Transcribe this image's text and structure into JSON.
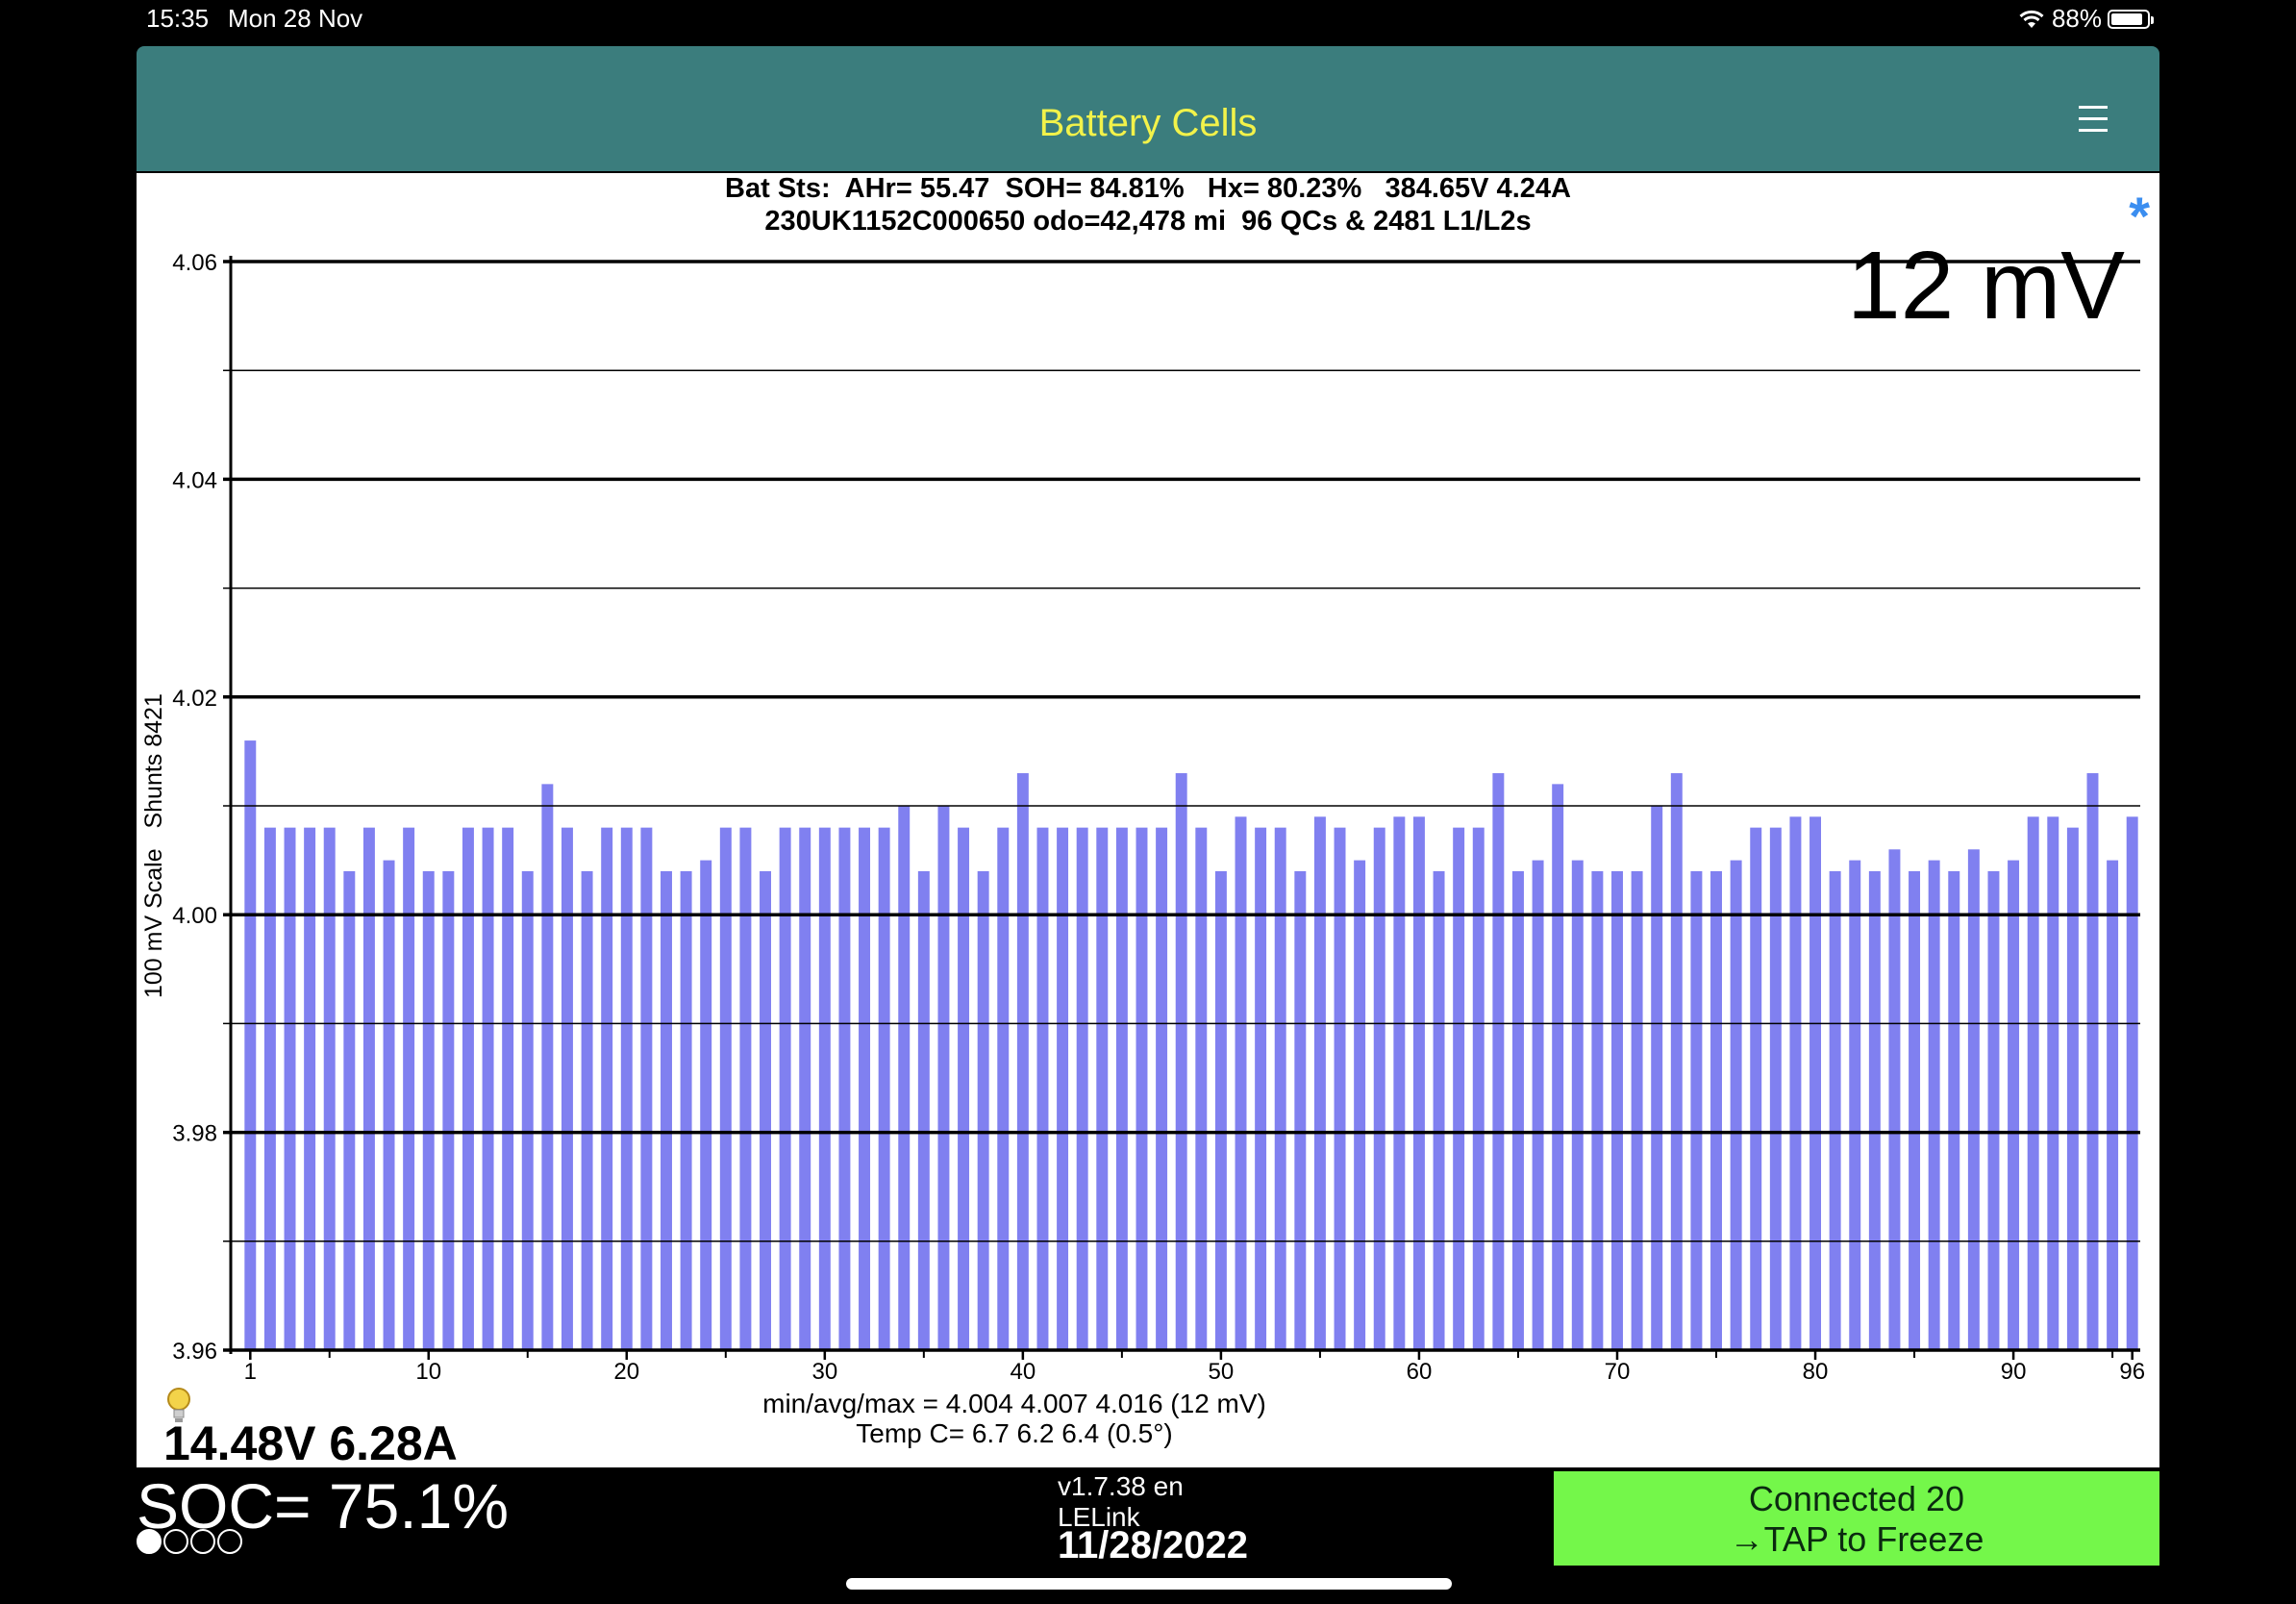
{
  "status_bar": {
    "time": "15:35",
    "date": "Mon 28 Nov",
    "battery_percent": "88%",
    "battery_level": 0.88,
    "icons": [
      "wifi-icon",
      "battery-icon"
    ]
  },
  "header": {
    "title": "Battery Cells",
    "menu_icon": "hamburger-menu-icon"
  },
  "summary": {
    "line1": "Bat Sts:  AHr= 55.47  SOH= 84.81%   Hx= 80.23%   384.65V 4.24A",
    "line2": "230UK1152C000650 odo=42,478 mi  96 QCs & 2481 L1/L2s",
    "connection_icon": "bluetooth-asterisk-icon",
    "spread_label": "12 mV"
  },
  "chart_data": {
    "type": "bar",
    "title": "",
    "ylabel": "100 mV Scale   Shunts 8421",
    "ylim": [
      3.96,
      4.06
    ],
    "y_ticks": [
      "3.96",
      "3.98",
      "4.00",
      "4.02",
      "4.04",
      "4.06"
    ],
    "y_minor_ticks": [
      3.97,
      3.99,
      4.01,
      4.03,
      4.05
    ],
    "x_tick_labels": [
      "1",
      "10",
      "20",
      "30",
      "40",
      "50",
      "60",
      "70",
      "80",
      "90",
      "96"
    ],
    "x_tick_values": [
      1,
      10,
      20,
      30,
      40,
      50,
      60,
      70,
      80,
      90,
      96
    ],
    "grid": true,
    "bar_color": "#8080f0",
    "categories": [
      1,
      2,
      3,
      4,
      5,
      6,
      7,
      8,
      9,
      10,
      11,
      12,
      13,
      14,
      15,
      16,
      17,
      18,
      19,
      20,
      21,
      22,
      23,
      24,
      25,
      26,
      27,
      28,
      29,
      30,
      31,
      32,
      33,
      34,
      35,
      36,
      37,
      38,
      39,
      40,
      41,
      42,
      43,
      44,
      45,
      46,
      47,
      48,
      49,
      50,
      51,
      52,
      53,
      54,
      55,
      56,
      57,
      58,
      59,
      60,
      61,
      62,
      63,
      64,
      65,
      66,
      67,
      68,
      69,
      70,
      71,
      72,
      73,
      74,
      75,
      76,
      77,
      78,
      79,
      80,
      81,
      82,
      83,
      84,
      85,
      86,
      87,
      88,
      89,
      90,
      91,
      92,
      93,
      94,
      95,
      96
    ],
    "values": [
      4.016,
      4.008,
      4.008,
      4.008,
      4.008,
      4.004,
      4.008,
      4.005,
      4.008,
      4.004,
      4.004,
      4.008,
      4.008,
      4.008,
      4.004,
      4.012,
      4.008,
      4.004,
      4.008,
      4.008,
      4.008,
      4.004,
      4.004,
      4.005,
      4.008,
      4.008,
      4.004,
      4.008,
      4.008,
      4.008,
      4.008,
      4.008,
      4.008,
      4.01,
      4.004,
      4.01,
      4.008,
      4.004,
      4.008,
      4.013,
      4.008,
      4.008,
      4.008,
      4.008,
      4.008,
      4.008,
      4.008,
      4.013,
      4.008,
      4.004,
      4.009,
      4.008,
      4.008,
      4.004,
      4.009,
      4.008,
      4.005,
      4.008,
      4.009,
      4.009,
      4.004,
      4.008,
      4.008,
      4.013,
      4.004,
      4.005,
      4.012,
      4.005,
      4.004,
      4.004,
      4.004,
      4.01,
      4.013,
      4.004,
      4.004,
      4.005,
      4.008,
      4.008,
      4.009,
      4.009,
      4.004,
      4.005,
      4.004,
      4.006,
      4.004,
      4.005,
      4.004,
      4.006,
      4.004,
      4.005,
      4.009,
      4.009,
      4.008,
      4.013,
      4.005,
      4.009
    ]
  },
  "stats": {
    "line1": "min/avg/max = 4.004 4.007 4.016  (12 mV)",
    "line2": "Temp C= 6.7  6.2  6.4  (0.5°)"
  },
  "aux_battery": {
    "text": "14.48V 6.28A",
    "icon": "lightbulb-icon"
  },
  "footer": {
    "soc": "SOC= 75.1%",
    "page_dots_total": 4,
    "page_dot_active": 1,
    "version": "v1.7.38 en",
    "adapter": "LELink",
    "date": "11/28/2022",
    "connect_line1": "Connected 20",
    "connect_line2": "→TAP to Freeze",
    "connect_color": "#74f74a"
  }
}
